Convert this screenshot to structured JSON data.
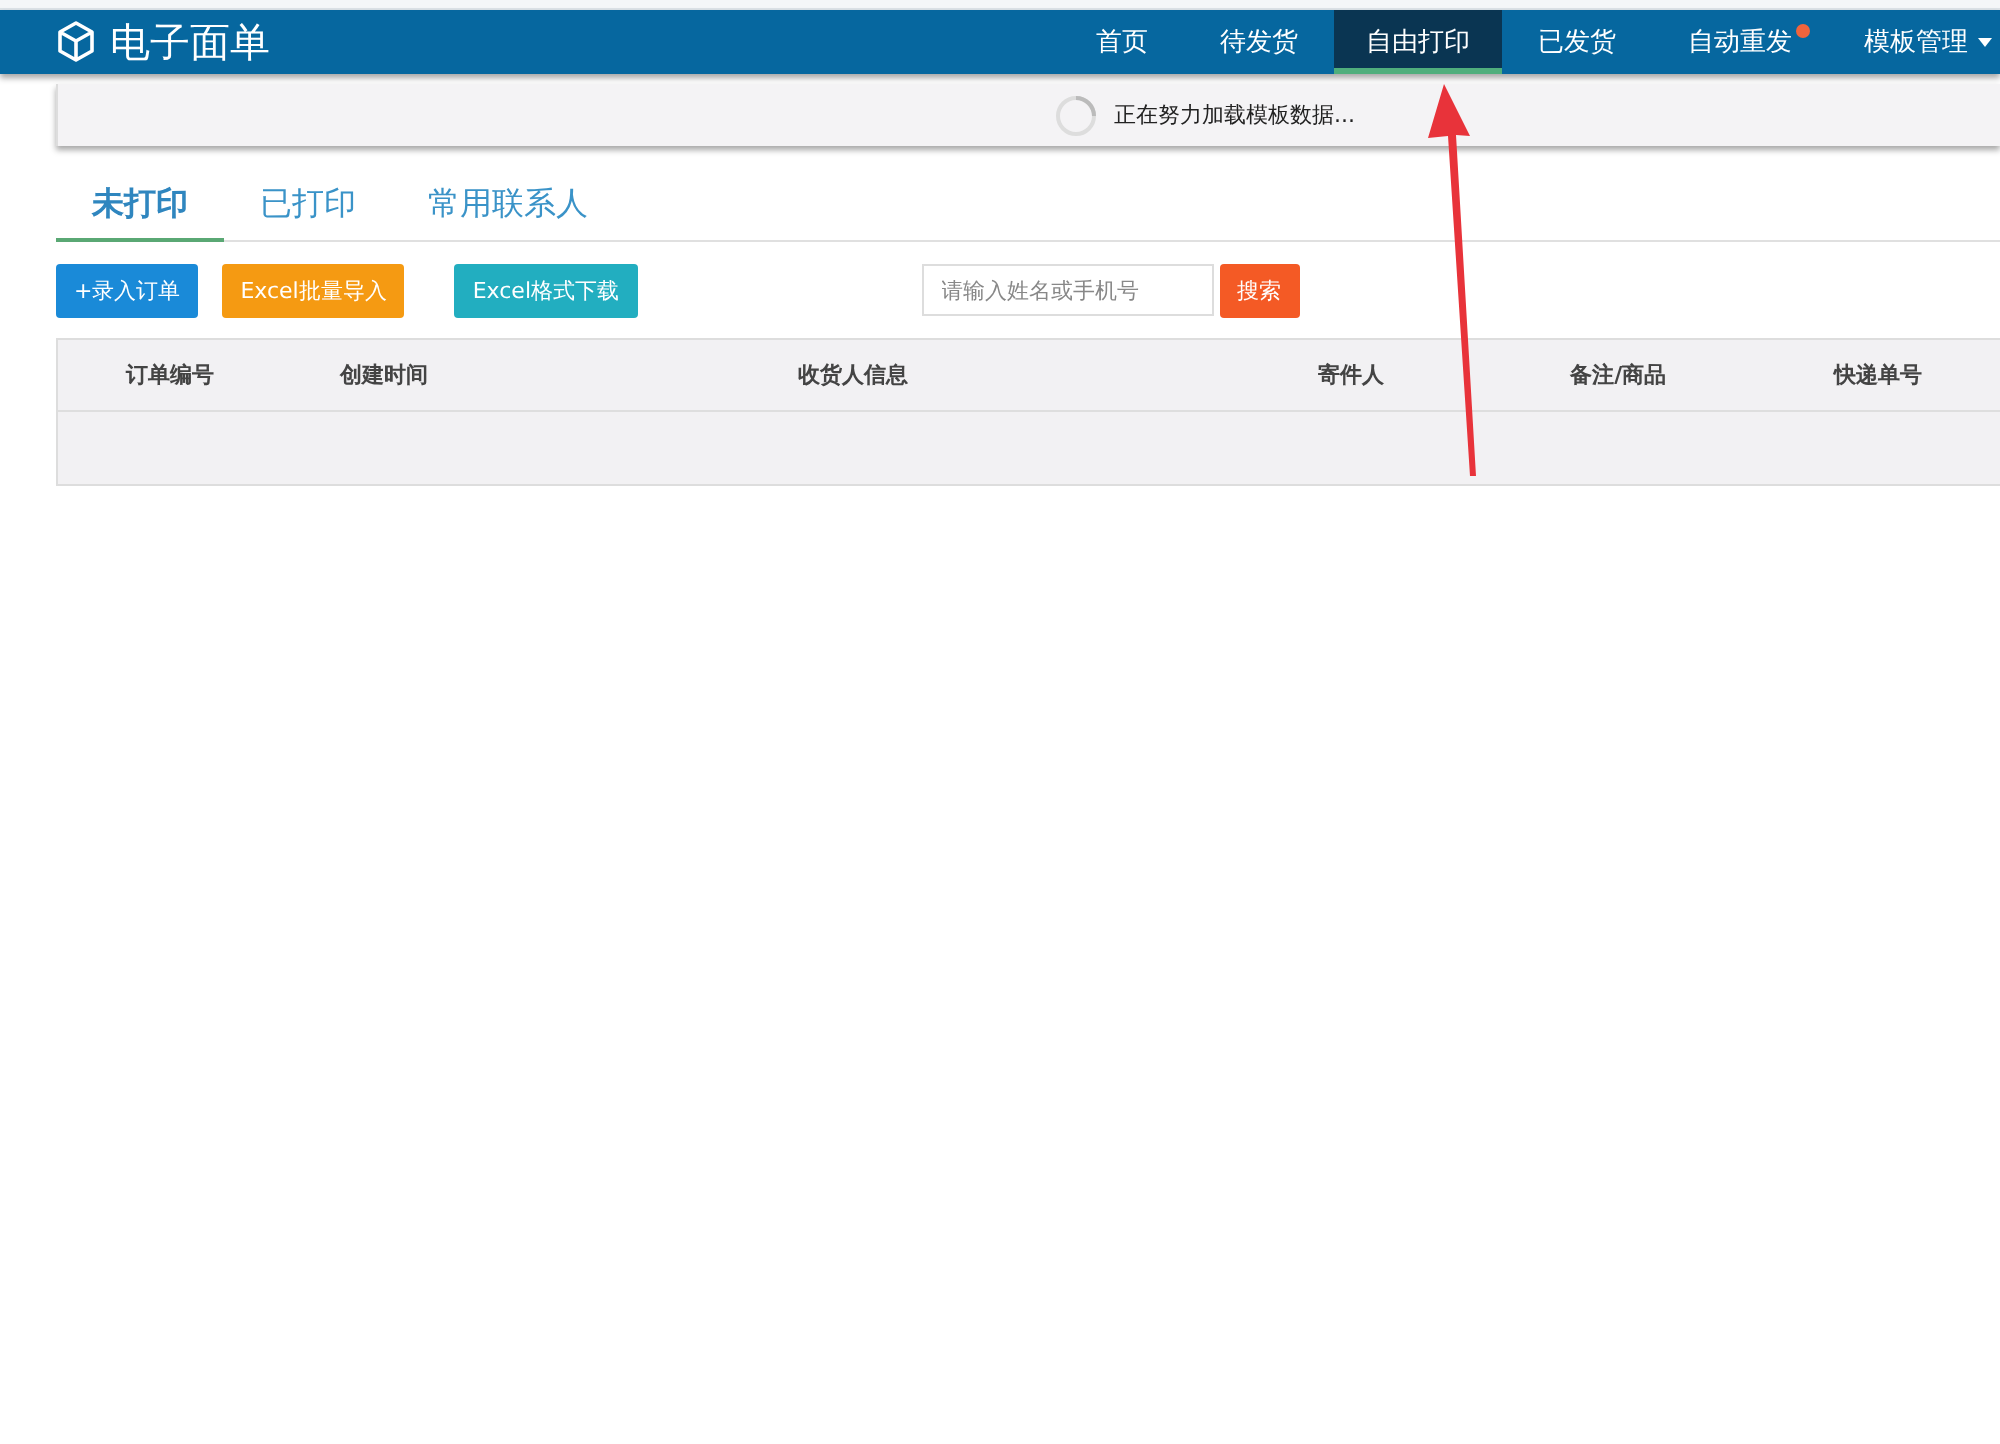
{
  "app": {
    "title": "电子面单"
  },
  "nav": [
    {
      "label": "首页",
      "selected": false,
      "dot": false,
      "dropdown": false
    },
    {
      "label": "待发货",
      "selected": false,
      "dot": false,
      "dropdown": false
    },
    {
      "label": "自由打印",
      "selected": true,
      "dot": false,
      "dropdown": false
    },
    {
      "label": "已发货",
      "selected": false,
      "dot": false,
      "dropdown": false
    },
    {
      "label": "自动重发",
      "selected": false,
      "dot": true,
      "dropdown": false
    },
    {
      "label": "模板管理",
      "selected": false,
      "dot": false,
      "dropdown": true
    }
  ],
  "loading": {
    "message": "正在努力加载模板数据..."
  },
  "tabs": [
    {
      "label": "未打印",
      "selected": true
    },
    {
      "label": "已打印",
      "selected": false
    },
    {
      "label": "常用联系人",
      "selected": false
    }
  ],
  "toolbar": {
    "buttons": [
      {
        "label": "+录入订单",
        "kind": "primary"
      },
      {
        "label": "Excel批量导入",
        "kind": "warning"
      },
      {
        "label": "Excel格式下载",
        "kind": "info"
      }
    ],
    "search": {
      "placeholder": "请输入姓名或手机号"
    },
    "search_button": "搜索"
  },
  "table": {
    "columns": [
      "订单编号",
      "创建时间",
      "收货人信息",
      "寄件人",
      "备注/商品",
      "快递单号"
    ]
  }
}
